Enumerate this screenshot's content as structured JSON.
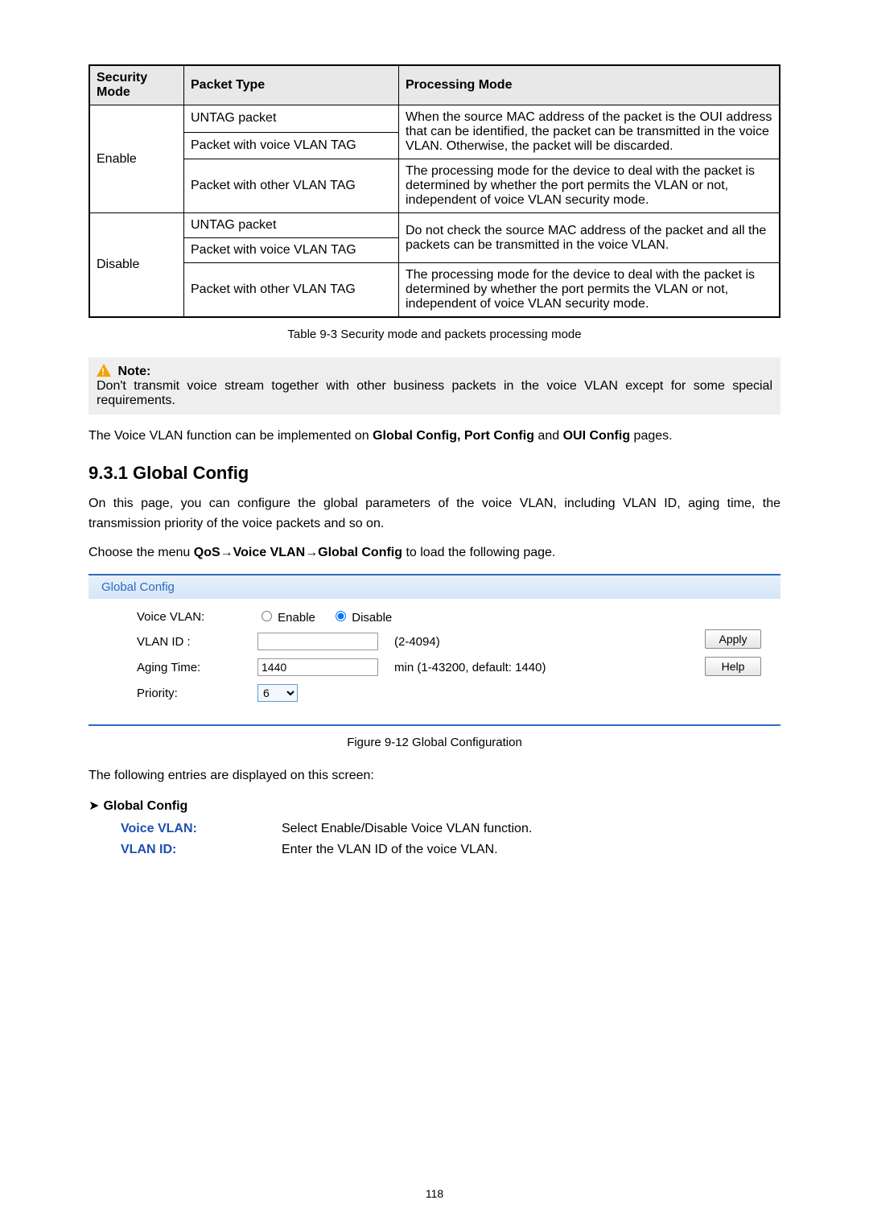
{
  "table": {
    "head": {
      "col1": "Security Mode",
      "col2": "Packet Type",
      "col3": "Processing Mode"
    },
    "r1_mode": "Enable",
    "r1_pt1": "UNTAG packet",
    "r1_pt2": "Packet with voice VLAN TAG",
    "r1_pt3": "Packet with other VLAN TAG",
    "r1_pm1": "When the source MAC address of the packet is the OUI address that can be identified, the packet can be transmitted in the voice VLAN. Otherwise, the packet will be discarded.",
    "r1_pm2": "The processing mode for the device to deal with the packet is determined by whether the port permits the VLAN or not, independent of voice VLAN security mode.",
    "r2_mode": "Disable",
    "r2_pt1": "UNTAG packet",
    "r2_pt2": "Packet with voice VLAN TAG",
    "r2_pt3": "Packet with other VLAN TAG",
    "r2_pm1": "Do not check the source MAC address of the packet and all the packets can be transmitted in the voice VLAN.",
    "r2_pm2": "The processing mode for the device to deal with the packet is determined by whether the port permits the VLAN or not, independent of voice VLAN security mode."
  },
  "caption1": "Table 9-3 Security mode and packets processing mode",
  "note": {
    "label": "Note:",
    "text": "Don't transmit voice stream together with other business packets in the voice VLAN except for some special requirements."
  },
  "intro1_a": "The Voice VLAN function can be implemented on ",
  "intro1_b": "Global Config, Port Config",
  "intro1_c": " and ",
  "intro1_d": "OUI Config",
  "intro1_e": " pages.",
  "section_title": "9.3.1 Global Config",
  "section_body": "On this page, you can configure the global parameters of the voice VLAN, including VLAN ID, aging time, the transmission priority of the voice packets and so on.",
  "menu_line_a": "Choose the menu ",
  "menu_line_b": "QoS→Voice VLAN→Global Config",
  "menu_line_c": " to load the following page.",
  "panel": {
    "header": "Global Config",
    "voice_label": "Voice VLAN:",
    "enable": "Enable",
    "disable": "Disable",
    "vlanid_label": "VLAN ID :",
    "vlanid_hint": "(2-4094)",
    "aging_label": "Aging Time:",
    "aging_value": "1440",
    "aging_hint": "min (1-43200, default: 1440)",
    "priority_label": "Priority:",
    "priority_value": "6",
    "apply": "Apply",
    "help": "Help"
  },
  "caption2": "Figure 9-12 Global Configuration",
  "entries_intro": "The following entries are displayed on this screen:",
  "bullet_label": "Global Config",
  "entries": {
    "voice_label": "Voice VLAN:",
    "voice_desc": "Select Enable/Disable Voice VLAN function.",
    "vlan_label": "VLAN ID:",
    "vlan_desc": "Enter the VLAN ID of the voice VLAN."
  },
  "page_number": "118"
}
